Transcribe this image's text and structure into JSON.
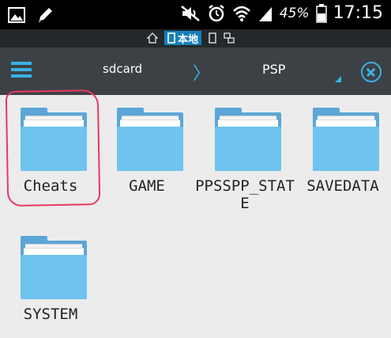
{
  "statusbar": {
    "battery_percent": "45%",
    "time": "17:15"
  },
  "locbar": {
    "active_label": "本地"
  },
  "path": {
    "parent": "sdcard",
    "separator": "〉",
    "current": "PSP"
  },
  "folders": [
    {
      "name": "Cheats"
    },
    {
      "name": "GAME"
    },
    {
      "name": "PPSSPP_STATE"
    },
    {
      "name": "SAVEDATA"
    },
    {
      "name": "SYSTEM"
    }
  ],
  "colors": {
    "accent": "#3ab0e2",
    "folder_front": "#6ec4ef",
    "folder_back": "#5ba6d6",
    "highlight": "#e83860"
  }
}
